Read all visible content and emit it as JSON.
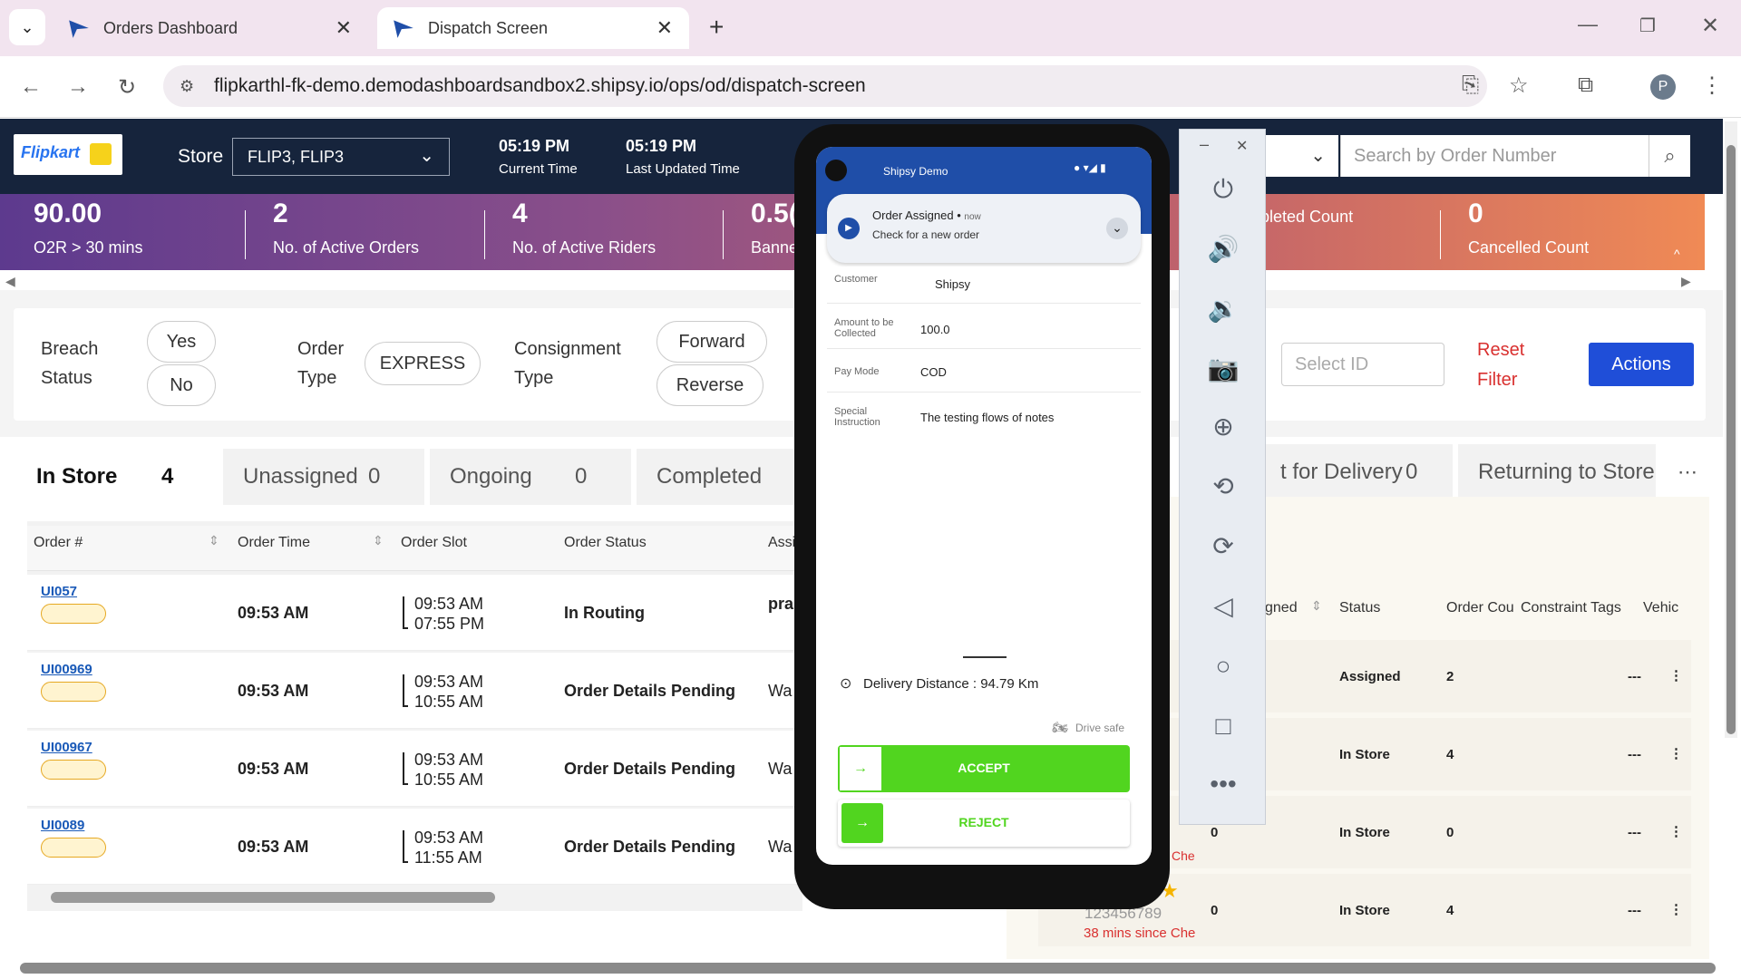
{
  "browser": {
    "tabs": [
      {
        "title": "Orders Dashboard"
      },
      {
        "title": "Dispatch Screen"
      }
    ],
    "url": "flipkarthl-fk-demo.demodashboardsandbox2.shipsy.io/ops/od/dispatch-screen",
    "profile_initial": "P"
  },
  "header": {
    "logo_text": "Flipkart",
    "store_label": "Store",
    "store_value": "FLIP3, FLIP3",
    "current_time": "05:19 PM",
    "current_time_label": "Current Time",
    "updated_time": "05:19 PM",
    "updated_time_label": "Last Updated Time",
    "search_placeholder": "Search by Order Number"
  },
  "stats": [
    {
      "value": "90.00",
      "label": "O2R > 30 mins"
    },
    {
      "value": "2",
      "label": "No. of Active Orders"
    },
    {
      "value": "4",
      "label": "No. of Active Riders"
    },
    {
      "value": "0.5(",
      "label": "Banne"
    },
    {
      "value": "",
      "label": "pleted Count"
    },
    {
      "value": "0",
      "label": "Cancelled Count"
    }
  ],
  "filters": {
    "breach_label": "Breach Status",
    "breach_yes": "Yes",
    "breach_no": "No",
    "order_type_label": "Order Type",
    "order_type_value": "EXPRESS",
    "consignment_label": "Consignment Type",
    "forward": "Forward",
    "reverse": "Reverse",
    "select_id_placeholder": "Select ID",
    "reset": "Reset Filter",
    "actions": "Actions"
  },
  "order_tabs": [
    {
      "label": "In Store",
      "count": "4"
    },
    {
      "label": "Unassigned",
      "count": "0"
    },
    {
      "label": "Ongoing",
      "count": "0"
    },
    {
      "label": "Completed",
      "count": ""
    }
  ],
  "rider_tabs": [
    {
      "label": "t for Delivery",
      "count": "0"
    },
    {
      "label": "Returning to Store",
      "count": ""
    }
  ],
  "more": "⋯",
  "orders_table": {
    "headers": [
      "Order #",
      "Order Time",
      "Order Slot",
      "Order Status",
      "Assi"
    ],
    "rows": [
      {
        "id": "UI057",
        "time": "09:53 AM",
        "slot_start": "09:53 AM",
        "slot_end": "07:55 PM",
        "status": "In Routing",
        "assigned": "pra"
      },
      {
        "id": "UI00969",
        "time": "09:53 AM",
        "slot_start": "09:53 AM",
        "slot_end": "10:55 AM",
        "status": "Order Details Pending",
        "assigned": "Wa"
      },
      {
        "id": "UI00967",
        "time": "09:53 AM",
        "slot_start": "09:53 AM",
        "slot_end": "10:55 AM",
        "status": "Order Details Pending",
        "assigned": "Wa"
      },
      {
        "id": "UI0089",
        "time": "09:53 AM",
        "slot_start": "09:53 AM",
        "slot_end": "11:55 AM",
        "status": "Order Details Pending",
        "assigned": "Wa"
      }
    ]
  },
  "riders_table": {
    "headers": [
      "gned",
      "Status",
      "Order Cou",
      "Constraint Tags",
      "Vehic"
    ],
    "rows": [
      {
        "assigned": "",
        "status": "Assigned",
        "count": "2",
        "tags": "---"
      },
      {
        "assigned": "",
        "status": "In Store",
        "count": "4",
        "tags": "---"
      },
      {
        "assigned": "0",
        "status": "In Store",
        "count": "0",
        "tags": "---"
      },
      {
        "assigned": "0",
        "status": "In Store",
        "count": "4",
        "tags": "---"
      }
    ],
    "partial_phone": "123456789",
    "partial_since": "38 mins since Che",
    "partial_che": "Che"
  },
  "phone": {
    "app_name": "Shipsy Demo",
    "notif_title": "Order Assigned",
    "notif_time": "now",
    "notif_body": "Check for a new order",
    "customer_label": "Customer",
    "customer_value": "Shipsy",
    "amount_label": "Amount to be Collected",
    "amount_value": "100.0",
    "paymode_label": "Pay Mode",
    "paymode_value": "COD",
    "instruction_label": "Special Instruction",
    "instruction_value": "The testing flows of notes",
    "distance": "Delivery Distance : 94.79 Km",
    "drive_safe": "Drive safe",
    "accept": "ACCEPT",
    "reject": "REJECT"
  }
}
